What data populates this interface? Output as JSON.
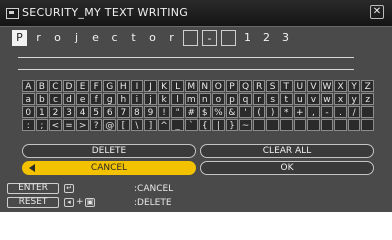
{
  "window": {
    "title": "SECURITY_MY TEXT WRITING",
    "close_glyph": "✕"
  },
  "text_entry": {
    "chars": [
      "P",
      "r",
      "o",
      "j",
      "e",
      "c",
      "t",
      "o",
      "r",
      "",
      "-",
      "",
      "1",
      "2",
      "3"
    ]
  },
  "keyboard": {
    "rows": [
      [
        "A",
        "B",
        "C",
        "D",
        "E",
        "F",
        "G",
        "H",
        "I",
        "J",
        "K",
        "L",
        "M",
        "N",
        "O",
        "P",
        "Q",
        "R",
        "S",
        "T",
        "U",
        "V",
        "W",
        "X",
        "Y",
        "Z"
      ],
      [
        "a",
        "b",
        "c",
        "d",
        "e",
        "f",
        "g",
        "h",
        "i",
        "j",
        "k",
        "l",
        "m",
        "n",
        "o",
        "p",
        "q",
        "r",
        "s",
        "t",
        "u",
        "v",
        "w",
        "x",
        "y",
        "z"
      ],
      [
        "0",
        "1",
        "2",
        "3",
        "4",
        "5",
        "6",
        "7",
        "8",
        "9",
        "!",
        "\"",
        "#",
        "$",
        "%",
        "&",
        "'",
        "(",
        ")",
        "*",
        "+",
        ",",
        "-",
        ".",
        "/",
        ""
      ],
      [
        ":",
        ";",
        "<",
        "=",
        ">",
        "?",
        "@",
        "[",
        "\\",
        "]",
        "^",
        "_",
        "`",
        "{",
        "|",
        "}",
        "~",
        "",
        "",
        "",
        "",
        "",
        "",
        "",
        "",
        ""
      ]
    ]
  },
  "buttons": {
    "delete": "DELETE",
    "clear_all": "CLEAR ALL",
    "cancel": "CANCEL",
    "ok": "OK"
  },
  "footer": {
    "enter_label": "ENTER",
    "reset_label": "RESET",
    "enter_action": ":CANCEL",
    "reset_action": ":DELETE",
    "enter_icon": "↵",
    "reset_icon_a": "◂",
    "reset_icon_b": "▣",
    "plus": "+"
  },
  "colors": {
    "highlight": "#f2c100",
    "panel": "#4a4a4a",
    "titlebar": "#1e1e1e"
  }
}
